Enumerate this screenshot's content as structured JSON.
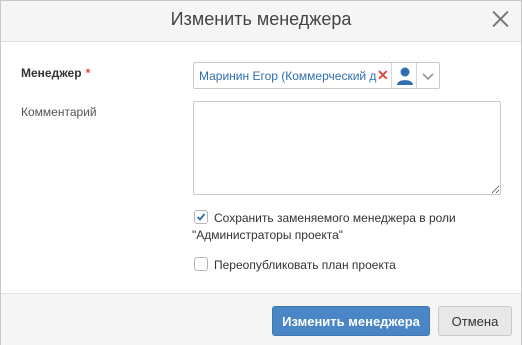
{
  "dialog": {
    "title": "Изменить менеджера",
    "close_icon": "close-icon"
  },
  "form": {
    "manager_label": "Менеджер",
    "required_mark": "*",
    "manager_value": "Маринин Егор (Коммерческий д",
    "clear_icon": "clear-x-icon",
    "user_icon": "user-icon",
    "dropdown_icon": "chevron-down-icon",
    "comment_label": "Комментарий",
    "comment_value": "",
    "keep_manager_label_line1": "Сохранить заменяемого менеджера в роли",
    "keep_manager_label_line2": "\"Администраторы проекта\"",
    "keep_manager_checked": true,
    "republish_label": "Переопубликовать план проекта",
    "republish_checked": false
  },
  "buttons": {
    "submit_label": "Изменить менеджера",
    "cancel_label": "Отмена"
  },
  "colors": {
    "primary": "#4a86c5",
    "link": "#2f6fb0",
    "required": "#e0473c"
  }
}
